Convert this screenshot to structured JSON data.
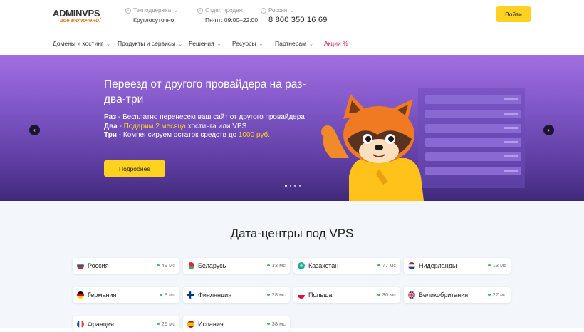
{
  "header": {
    "logo_main": "ADMINVPS",
    "logo_sub": "все включено!",
    "support": {
      "label": "Техподдержка",
      "value": "Круглосуточно"
    },
    "sales": {
      "label": "Отдел продаж",
      "value": "Пн-пт: 09:00–22:00"
    },
    "region": {
      "label": "Россия",
      "phone": "8 800 350 16 69"
    },
    "login_label": "Войти"
  },
  "nav": {
    "items": [
      {
        "label": "Домены и хостинг"
      },
      {
        "label": "Продукты и сервисы"
      },
      {
        "label": "Решения"
      },
      {
        "label": "Ресурсы"
      },
      {
        "label": "Партнерам"
      }
    ],
    "promo": "Акции %"
  },
  "hero": {
    "title": "Переезд от другого провайдера на раз-два-три",
    "line1_key": "Раз",
    "line1_text": " - Бесплатно перенесем ваш сайт от другого провайдера",
    "line2_key": "Два",
    "line2_sep": " - ",
    "line2_highlight": "Подарим 2 месяца",
    "line2_text": " хостинга или VPS",
    "line3_key": "Три",
    "line3_text": " - Компенсируем остаток средств до ",
    "line3_highlight": "1000 руб.",
    "button_label": "Подробнее",
    "slide_count": 4,
    "active_slide": 1
  },
  "datacenters": {
    "title": "Дата-центры под VPS",
    "items": [
      {
        "country": "Россия",
        "ping": "49 мс",
        "flag": "ru"
      },
      {
        "country": "Беларусь",
        "ping": "33 мс",
        "flag": "by"
      },
      {
        "country": "Казахстан",
        "ping": "77 мс",
        "flag": "kz"
      },
      {
        "country": "Нидерланды",
        "ping": "13 мс",
        "flag": "nl"
      },
      {
        "country": "Германия",
        "ping": "8 мс",
        "flag": "de"
      },
      {
        "country": "Финляндия",
        "ping": "28 мс",
        "flag": "fi"
      },
      {
        "country": "Польша",
        "ping": "36 мс",
        "flag": "pl"
      },
      {
        "country": "Великобритания",
        "ping": "27 мс",
        "flag": "gb"
      },
      {
        "country": "Франция",
        "ping": "26 мс",
        "flag": "fr"
      },
      {
        "country": "Испания",
        "ping": "38 мс",
        "flag": "es"
      }
    ]
  },
  "colors": {
    "accent": "#ffd21f",
    "promo": "#e0245e",
    "brand_orange": "#f07a21",
    "ping_ok": "#3bbf5c"
  }
}
